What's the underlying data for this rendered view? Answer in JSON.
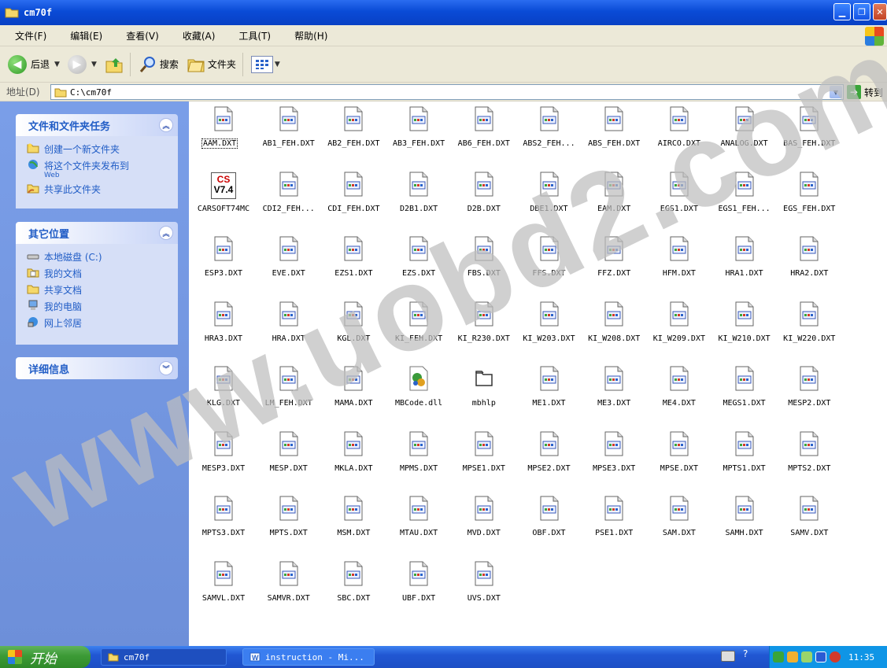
{
  "window": {
    "title": "cm70f"
  },
  "menu": [
    "文件(F)",
    "编辑(E)",
    "查看(V)",
    "收藏(A)",
    "工具(T)",
    "帮助(H)"
  ],
  "toolbar": {
    "back": "后退",
    "search": "搜索",
    "folders": "文件夹"
  },
  "address": {
    "label": "地址(D)",
    "value": "C:\\cm70f",
    "go": "转到"
  },
  "left_pane": {
    "tasks": {
      "title": "文件和文件夹任务",
      "items": [
        {
          "label": "创建一个新文件夹"
        },
        {
          "label": "将这个文件夹发布到",
          "sub": "Web"
        },
        {
          "label": "共享此文件夹"
        }
      ]
    },
    "places": {
      "title": "其它位置",
      "items": [
        "本地磁盘 (C:)",
        "我的文档",
        "共享文档",
        "我的电脑",
        "网上邻居"
      ]
    },
    "details": {
      "title": "详细信息"
    }
  },
  "files": [
    {
      "name": "AAM.DXT",
      "type": "dxt",
      "selected": true
    },
    {
      "name": "AB1_FEH.DXT",
      "type": "dxt"
    },
    {
      "name": "AB2_FEH.DXT",
      "type": "dxt"
    },
    {
      "name": "AB3_FEH.DXT",
      "type": "dxt"
    },
    {
      "name": "AB6_FEH.DXT",
      "type": "dxt"
    },
    {
      "name": "ABS2_FEH...",
      "type": "dxt"
    },
    {
      "name": "ABS_FEH.DXT",
      "type": "dxt"
    },
    {
      "name": "AIRCO.DXT",
      "type": "dxt"
    },
    {
      "name": "ANALOG.DXT",
      "type": "dxt"
    },
    {
      "name": "BAS_FEH.DXT",
      "type": "dxt"
    },
    {
      "name": "CARSOFT74MC",
      "type": "cs",
      "icon_text": [
        "CS",
        "V7.4"
      ]
    },
    {
      "name": "CDI2_FEH...",
      "type": "dxt"
    },
    {
      "name": "CDI_FEH.DXT",
      "type": "dxt"
    },
    {
      "name": "D2B1.DXT",
      "type": "dxt"
    },
    {
      "name": "D2B.DXT",
      "type": "dxt"
    },
    {
      "name": "DBE1.DXT",
      "type": "dxt"
    },
    {
      "name": "EAM.DXT",
      "type": "dxt"
    },
    {
      "name": "EGS1.DXT",
      "type": "dxt"
    },
    {
      "name": "EGS1_FEH...",
      "type": "dxt"
    },
    {
      "name": "EGS_FEH.DXT",
      "type": "dxt"
    },
    {
      "name": "ESP3.DXT",
      "type": "dxt"
    },
    {
      "name": "EVE.DXT",
      "type": "dxt"
    },
    {
      "name": "EZS1.DXT",
      "type": "dxt"
    },
    {
      "name": "EZS.DXT",
      "type": "dxt"
    },
    {
      "name": "FBS.DXT",
      "type": "dxt"
    },
    {
      "name": "FFS.DXT",
      "type": "dxt"
    },
    {
      "name": "FFZ.DXT",
      "type": "dxt"
    },
    {
      "name": "HFM.DXT",
      "type": "dxt"
    },
    {
      "name": "HRA1.DXT",
      "type": "dxt"
    },
    {
      "name": "HRA2.DXT",
      "type": "dxt"
    },
    {
      "name": "HRA3.DXT",
      "type": "dxt"
    },
    {
      "name": "HRA.DXT",
      "type": "dxt"
    },
    {
      "name": "KGL.DXT",
      "type": "dxt"
    },
    {
      "name": "KI_FEH.DXT",
      "type": "dxt"
    },
    {
      "name": "KI_R230.DXT",
      "type": "dxt"
    },
    {
      "name": "KI_W203.DXT",
      "type": "dxt"
    },
    {
      "name": "KI_W208.DXT",
      "type": "dxt"
    },
    {
      "name": "KI_W209.DXT",
      "type": "dxt"
    },
    {
      "name": "KI_W210.DXT",
      "type": "dxt"
    },
    {
      "name": "KI_W220.DXT",
      "type": "dxt"
    },
    {
      "name": "KLG.DXT",
      "type": "dxt"
    },
    {
      "name": "LM_FEH.DXT",
      "type": "dxt"
    },
    {
      "name": "MAMA.DXT",
      "type": "dxt"
    },
    {
      "name": "MBCode.dll",
      "type": "dll"
    },
    {
      "name": "mbhlp",
      "type": "folder"
    },
    {
      "name": "ME1.DXT",
      "type": "dxt"
    },
    {
      "name": "ME3.DXT",
      "type": "dxt"
    },
    {
      "name": "ME4.DXT",
      "type": "dxt"
    },
    {
      "name": "MEGS1.DXT",
      "type": "dxt"
    },
    {
      "name": "MESP2.DXT",
      "type": "dxt"
    },
    {
      "name": "MESP3.DXT",
      "type": "dxt"
    },
    {
      "name": "MESP.DXT",
      "type": "dxt"
    },
    {
      "name": "MKLA.DXT",
      "type": "dxt"
    },
    {
      "name": "MPMS.DXT",
      "type": "dxt"
    },
    {
      "name": "MPSE1.DXT",
      "type": "dxt"
    },
    {
      "name": "MPSE2.DXT",
      "type": "dxt"
    },
    {
      "name": "MPSE3.DXT",
      "type": "dxt"
    },
    {
      "name": "MPSE.DXT",
      "type": "dxt"
    },
    {
      "name": "MPTS1.DXT",
      "type": "dxt"
    },
    {
      "name": "MPTS2.DXT",
      "type": "dxt"
    },
    {
      "name": "MPTS3.DXT",
      "type": "dxt"
    },
    {
      "name": "MPTS.DXT",
      "type": "dxt"
    },
    {
      "name": "MSM.DXT",
      "type": "dxt"
    },
    {
      "name": "MTAU.DXT",
      "type": "dxt"
    },
    {
      "name": "MVD.DXT",
      "type": "dxt"
    },
    {
      "name": "OBF.DXT",
      "type": "dxt"
    },
    {
      "name": "PSE1.DXT",
      "type": "dxt"
    },
    {
      "name": "SAM.DXT",
      "type": "dxt"
    },
    {
      "name": "SAMH.DXT",
      "type": "dxt"
    },
    {
      "name": "SAMV.DXT",
      "type": "dxt"
    },
    {
      "name": "SAMVL.DXT",
      "type": "dxt"
    },
    {
      "name": "SAMVR.DXT",
      "type": "dxt"
    },
    {
      "name": "SBC.DXT",
      "type": "dxt"
    },
    {
      "name": "UBF.DXT",
      "type": "dxt"
    },
    {
      "name": "UVS.DXT",
      "type": "dxt"
    }
  ],
  "taskbar": {
    "start": "开始",
    "tasks": [
      "cm70f",
      "instruction - Mi..."
    ],
    "clock": "11:35"
  },
  "watermark": "www.uobd2.com",
  "colors": {
    "title_bar": "#0a4bd6",
    "task_pane": "#7a9ee8",
    "taskbar": "#2157d3",
    "start": "#3c9a36"
  }
}
